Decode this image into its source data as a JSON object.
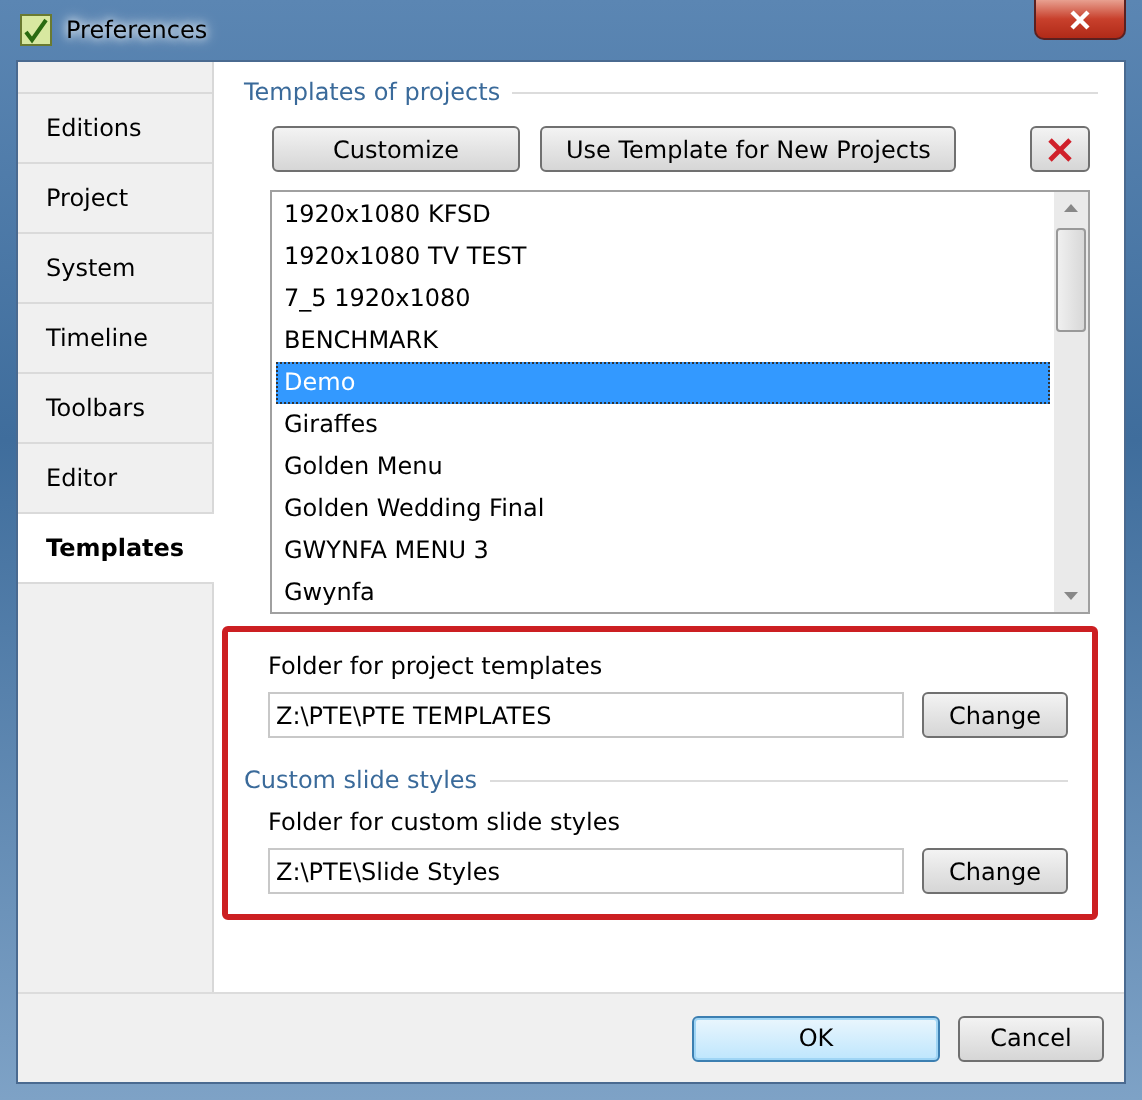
{
  "window": {
    "title": "Preferences"
  },
  "sidebar": {
    "items": [
      {
        "label": "Editions",
        "selected": false
      },
      {
        "label": "Project",
        "selected": false
      },
      {
        "label": "System",
        "selected": false
      },
      {
        "label": "Timeline",
        "selected": false
      },
      {
        "label": "Toolbars",
        "selected": false
      },
      {
        "label": "Editor",
        "selected": false
      },
      {
        "label": "Templates",
        "selected": true
      }
    ]
  },
  "templates": {
    "heading": "Templates of projects",
    "buttons": [
      "Customize",
      "Use Template for New Projects"
    ],
    "list": [
      {
        "label": "1920x1080 KFSD",
        "selected": false
      },
      {
        "label": "1920x1080 TV TEST",
        "selected": false
      },
      {
        "label": "7_5 1920x1080",
        "selected": false
      },
      {
        "label": "BENCHMARK",
        "selected": false
      },
      {
        "label": "Demo",
        "selected": true
      },
      {
        "label": "Giraffes",
        "selected": false
      },
      {
        "label": "Golden Menu",
        "selected": false
      },
      {
        "label": "Golden Wedding Final",
        "selected": false
      },
      {
        "label": "GWYNFA MENU 3",
        "selected": false
      },
      {
        "label": "Gwynfa",
        "selected": false
      }
    ]
  },
  "folders": [
    {
      "label": "Folder for project templates",
      "value": "Z:\\PTE\\PTE TEMPLATES",
      "button": "Change"
    },
    {
      "heading": "Custom slide styles",
      "label": "Folder for custom slide styles",
      "value": "Z:\\PTE\\Slide Styles",
      "button": "Change"
    }
  ],
  "buttons": [
    {
      "label": "OK",
      "kind": "default"
    },
    {
      "label": "Cancel",
      "kind": "normal"
    }
  ]
}
